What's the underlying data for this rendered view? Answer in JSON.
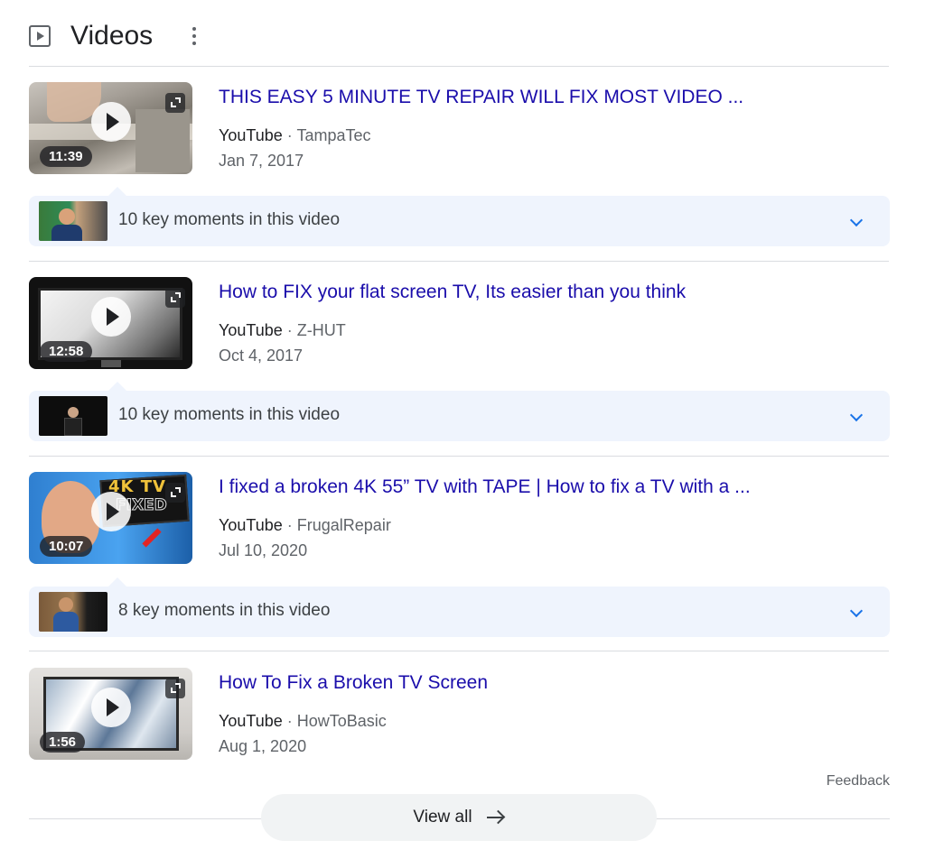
{
  "section": {
    "title": "Videos",
    "icon": "video-play-icon",
    "menu_icon": "more-vert-icon"
  },
  "videos": [
    {
      "title": "THIS EASY 5 MINUTE TV REPAIR WILL FIX MOST VIDEO ...",
      "site": "YouTube",
      "separator": "·",
      "channel": "TampaTec",
      "date": "Jan 7, 2017",
      "duration": "11:39",
      "key_moments": "10 key moments in this video"
    },
    {
      "title": "How to FIX your flat screen TV, Its easier than you think",
      "site": "YouTube",
      "separator": "·",
      "channel": "Z-HUT",
      "date": "Oct 4, 2017",
      "duration": "12:58",
      "key_moments": "10 key moments in this video"
    },
    {
      "title": "I fixed a broken 4K 55” TV with TAPE | How to fix a TV with a ...",
      "site": "YouTube",
      "separator": "·",
      "channel": "FrugalRepair",
      "date": "Jul 10, 2020",
      "duration": "10:07",
      "key_moments": "8 key moments in this video",
      "thumb_text": "4K TV",
      "thumb_text_2": "FIXED"
    },
    {
      "title": "How To Fix a Broken TV Screen",
      "site": "YouTube",
      "separator": "·",
      "channel": "HowToBasic",
      "date": "Aug 1, 2020",
      "duration": "1:56"
    }
  ],
  "footer": {
    "feedback": "Feedback",
    "view_all": "View all"
  },
  "colors": {
    "link": "#1a0dab",
    "moments_bg": "#eff4fd",
    "chevron": "#1a73e8"
  }
}
